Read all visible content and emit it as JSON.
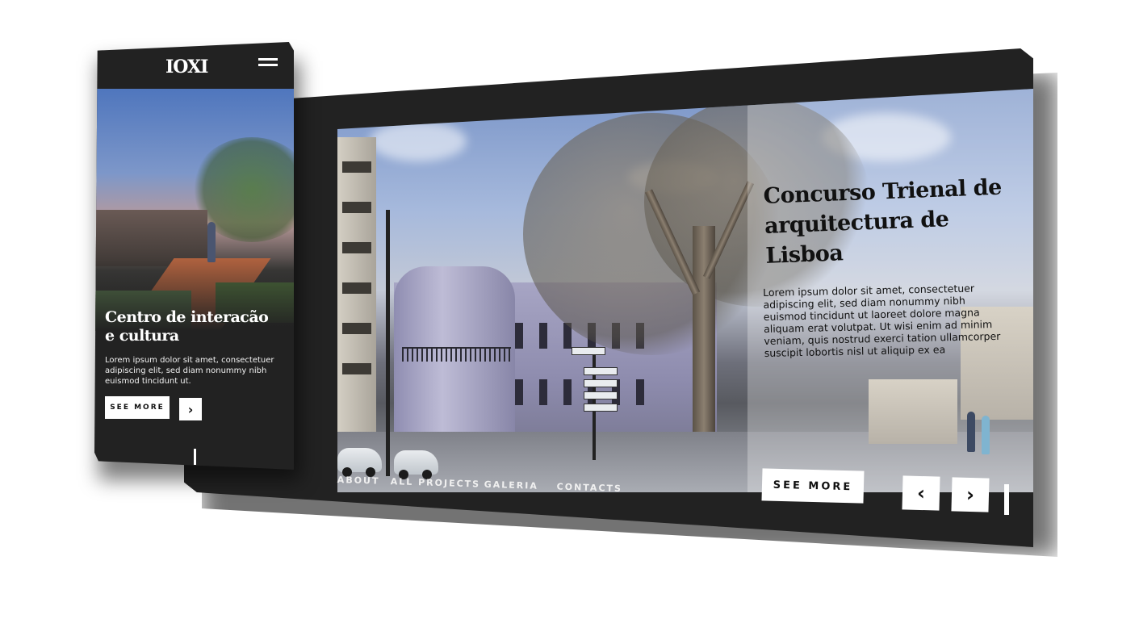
{
  "mobile": {
    "logo": "IOXI",
    "menu_icon": "hamburger-icon",
    "hero_title": "Centro de interacão e cultura",
    "hero_text": "Lorem ipsum dolor sit amet, consectetuer adipiscing elit, sed diam nonummy nibh euismod tincidunt ut.",
    "see_more_label": "SEE MORE",
    "next_icon": "chevron-right-icon"
  },
  "desktop": {
    "hero_title": "Concurso Trienal de arquitectura de Lisboa",
    "hero_text": "Lorem ipsum dolor sit amet, consectetuer adipiscing elit, sed diam nonummy nibh euismod tincidunt ut laoreet dolore magna aliquam erat volutpat. Ut wisi enim ad minim veniam, quis nostrud exerci tation ullamcorper suscipit lobortis nisl ut aliquip ex ea",
    "nav": [
      {
        "label": "ABOUT"
      },
      {
        "label": "ALL PROJECTS"
      },
      {
        "label": "GALERIA"
      },
      {
        "label": "CONTACTS"
      }
    ],
    "see_more_label": "SEE MORE",
    "prev_icon": "chevron-left-icon",
    "next_icon": "chevron-right-icon"
  },
  "colors": {
    "frame": "#222222",
    "button_bg": "#ffffff",
    "text_light": "#ffffff",
    "text_dark": "#111111"
  }
}
